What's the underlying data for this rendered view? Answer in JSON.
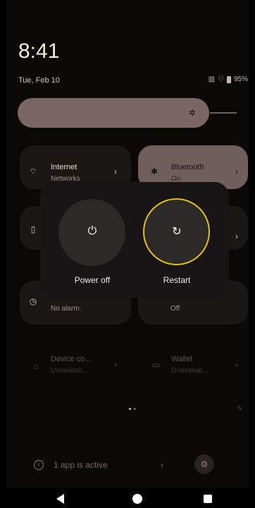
{
  "status": {
    "time": "8:41",
    "date": "Tue, Feb 10",
    "battery": "95%"
  },
  "brightness": {
    "icon": "brightness-icon",
    "level": 0.75
  },
  "tiles": [
    {
      "title": "Internet",
      "subtitle": "Networks",
      "icon": "wifi-icon",
      "active": false
    },
    {
      "title": "Bluetooth",
      "subtitle": "On",
      "icon": "bluetooth-icon",
      "active": true
    },
    {
      "title": "",
      "subtitle": "",
      "icon": "flashlight-icon",
      "active": false
    },
    {
      "title": "",
      "subtitle": "",
      "icon": "tile-icon",
      "active": false
    },
    {
      "title": "",
      "subtitle": "No alarm.",
      "icon": "alarm-icon",
      "active": false
    },
    {
      "title": "",
      "subtitle": "Off",
      "icon": "tile-icon",
      "active": false
    },
    {
      "title": "Device co...",
      "subtitle": "Unavailab...",
      "icon": "home-icon",
      "active": false
    },
    {
      "title": "Wallet",
      "subtitle": "Unavailab...",
      "icon": "wallet-icon",
      "active": false
    }
  ],
  "power_menu": {
    "power_off_label": "Power off",
    "restart_label": "Restart",
    "focused": "restart"
  },
  "footer": {
    "active_apps": "1 app is active"
  },
  "colors": {
    "accent_focus": "#e5c012",
    "bluetooth_tile": "#8a7470",
    "brightness_bar": "#7a6663"
  }
}
